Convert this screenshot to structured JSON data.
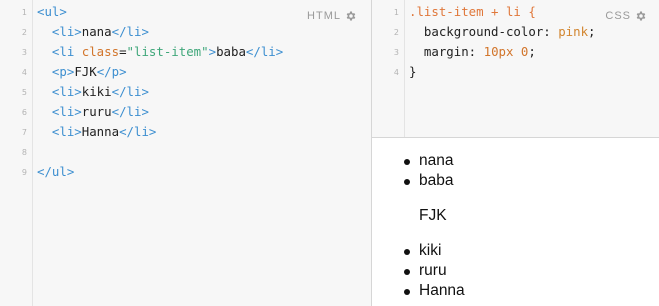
{
  "html_panel": {
    "label": "HTML",
    "line_numbers": [
      "1",
      "2",
      "3",
      "4",
      "5",
      "6",
      "7",
      "8",
      "9"
    ],
    "lines": [
      [
        {
          "t": "<",
          "c": "tag"
        },
        {
          "t": "ul",
          "c": "tag"
        },
        {
          "t": ">",
          "c": "tag"
        }
      ],
      [
        {
          "t": "  ",
          "c": "txt"
        },
        {
          "t": "<li>",
          "c": "tag"
        },
        {
          "t": "nana",
          "c": "txt"
        },
        {
          "t": "</li>",
          "c": "tag"
        }
      ],
      [
        {
          "t": "  ",
          "c": "txt"
        },
        {
          "t": "<li ",
          "c": "tag"
        },
        {
          "t": "class",
          "c": "attr"
        },
        {
          "t": "=",
          "c": "txt"
        },
        {
          "t": "\"list-item\"",
          "c": "str"
        },
        {
          "t": ">",
          "c": "tag"
        },
        {
          "t": "baba",
          "c": "txt"
        },
        {
          "t": "</li>",
          "c": "tag"
        }
      ],
      [
        {
          "t": "  ",
          "c": "txt"
        },
        {
          "t": "<p>",
          "c": "tag"
        },
        {
          "t": "FJK",
          "c": "txt"
        },
        {
          "t": "</p>",
          "c": "tag"
        }
      ],
      [
        {
          "t": "  ",
          "c": "txt"
        },
        {
          "t": "<li>",
          "c": "tag"
        },
        {
          "t": "kiki",
          "c": "txt"
        },
        {
          "t": "</li>",
          "c": "tag"
        }
      ],
      [
        {
          "t": "  ",
          "c": "txt"
        },
        {
          "t": "<li>",
          "c": "tag"
        },
        {
          "t": "ruru",
          "c": "txt"
        },
        {
          "t": "</li>",
          "c": "tag"
        }
      ],
      [
        {
          "t": "  ",
          "c": "txt"
        },
        {
          "t": "<li>",
          "c": "tag"
        },
        {
          "t": "Hanna",
          "c": "txt"
        },
        {
          "t": "</li>",
          "c": "tag"
        }
      ],
      [],
      [
        {
          "t": "</ul>",
          "c": "tag"
        }
      ]
    ]
  },
  "css_panel": {
    "label": "CSS",
    "line_numbers": [
      "1",
      "2",
      "3",
      "4"
    ],
    "lines": [
      [
        {
          "t": ".list-item + li {",
          "c": "sel"
        }
      ],
      [
        {
          "t": "  background-color: ",
          "c": "prop"
        },
        {
          "t": "pink",
          "c": "val"
        },
        {
          "t": ";",
          "c": "prop"
        }
      ],
      [
        {
          "t": "  margin: ",
          "c": "prop"
        },
        {
          "t": "10px 0",
          "c": "num"
        },
        {
          "t": ";",
          "c": "prop"
        }
      ],
      [
        {
          "t": "}",
          "c": "prop"
        }
      ]
    ]
  },
  "preview": {
    "items_top": [
      "nana",
      "baba"
    ],
    "paragraph": "FJK",
    "items_bottom": [
      "kiki",
      "ruru",
      "Hanna"
    ]
  },
  "icons": {
    "html_settings": "gear-icon",
    "css_settings": "gear-icon"
  }
}
